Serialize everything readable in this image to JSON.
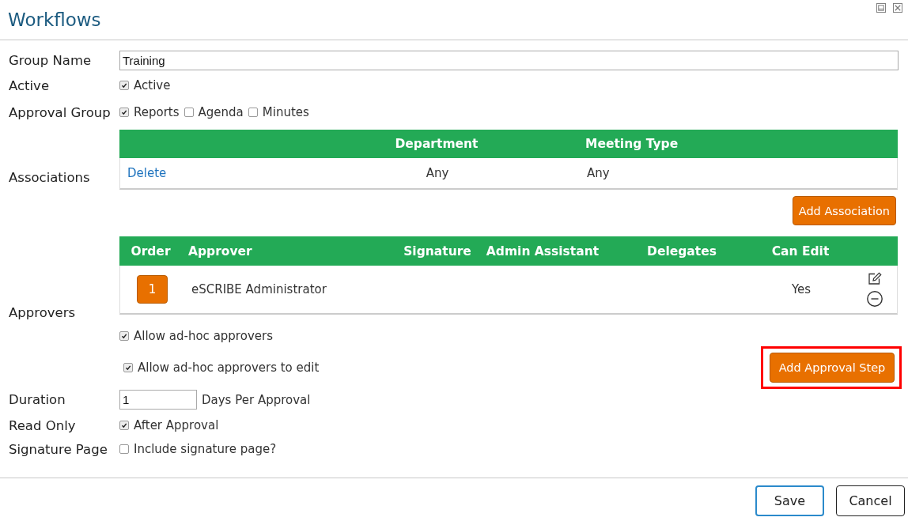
{
  "window": {
    "title": "Workflows"
  },
  "group_name": {
    "label": "Group Name",
    "value": "Training"
  },
  "active": {
    "label": "Active",
    "options": [
      {
        "label": "Active",
        "checked": true
      }
    ]
  },
  "approval_group": {
    "label": "Approval Group",
    "options": [
      {
        "label": "Reports",
        "checked": true
      },
      {
        "label": "Agenda",
        "checked": false
      },
      {
        "label": "Minutes",
        "checked": false
      }
    ]
  },
  "associations": {
    "label": "Associations",
    "columns": [
      "Department",
      "Meeting Type"
    ],
    "rows": [
      {
        "action": "Delete",
        "department": "Any",
        "meeting_type": "Any"
      }
    ],
    "add_button": "Add Association"
  },
  "approvers": {
    "label": "Approvers",
    "columns": [
      "Order",
      "Approver",
      "Signature",
      "Admin Assistant",
      "Delegates",
      "Can Edit"
    ],
    "rows": [
      {
        "order": "1",
        "approver": "eSCRIBE Administrator",
        "can_edit": "Yes"
      }
    ],
    "options": [
      {
        "label": "Allow ad-hoc approvers",
        "checked": true
      },
      {
        "label": "Allow ad-hoc approvers to edit",
        "checked": true
      }
    ],
    "add_button": {
      "label": "Add Approval Step",
      "highlighted": true
    }
  },
  "duration": {
    "label": "Duration",
    "value": "1",
    "unit": "Days Per Approval"
  },
  "read_only": {
    "label": "Read Only",
    "options": [
      {
        "label": "After Approval",
        "checked": true
      }
    ]
  },
  "signature_page": {
    "label": "Signature Page",
    "options": [
      {
        "label": "Include signature page?",
        "checked": false
      }
    ]
  },
  "buttons": [
    {
      "label": "Save",
      "focused": true
    },
    {
      "label": "Cancel",
      "focused": false
    }
  ]
}
